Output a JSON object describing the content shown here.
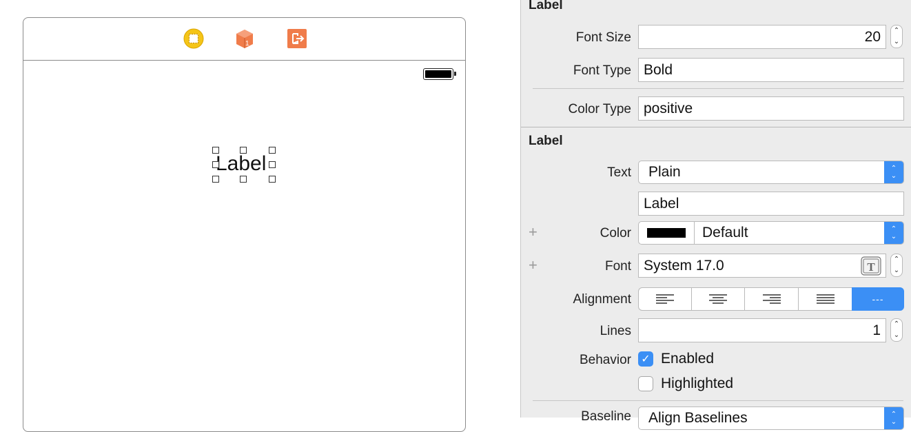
{
  "canvas": {
    "label_text": "Label",
    "dock": {
      "icons": [
        "view-controller-icon",
        "first-responder-icon",
        "exit-icon"
      ],
      "colors": {
        "view_controller": "#f5c518",
        "first_responder": "#f07c4a",
        "exit": "#f07c4a"
      }
    }
  },
  "inspector": {
    "custom_section": {
      "title": "Label",
      "font_size": {
        "label": "Font Size",
        "value": "20"
      },
      "font_type": {
        "label": "Font Type",
        "value": "Bold"
      },
      "color_type": {
        "label": "Color Type",
        "value": "positive"
      }
    },
    "label_section": {
      "title": "Label",
      "text": {
        "label": "Text",
        "value": "Plain"
      },
      "text_value": "Label",
      "color": {
        "label": "Color",
        "value": "Default",
        "swatch": "#000000"
      },
      "font": {
        "label": "Font",
        "value": "System 17.0"
      },
      "alignment": {
        "label": "Alignment",
        "options": [
          "left",
          "center",
          "right",
          "justified",
          "natural"
        ],
        "selected": "natural",
        "natural_glyph": "---"
      },
      "lines": {
        "label": "Lines",
        "value": "1"
      },
      "behavior": {
        "label": "Behavior",
        "enabled": {
          "label": "Enabled",
          "checked": true
        },
        "highlighted": {
          "label": "Highlighted",
          "checked": false
        }
      },
      "baseline": {
        "label": "Baseline",
        "value": "Align Baselines"
      }
    },
    "accent_color": "#3b8ff5"
  }
}
